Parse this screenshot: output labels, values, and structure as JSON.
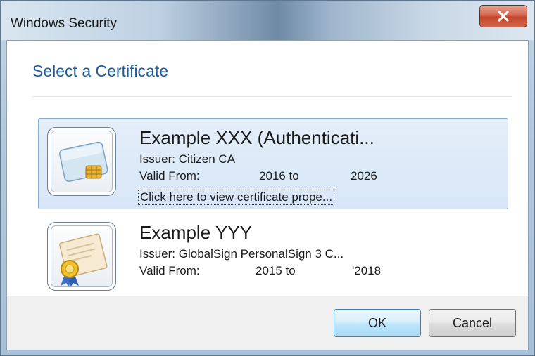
{
  "window": {
    "title": "Windows Security",
    "close_label": "X"
  },
  "dialog": {
    "heading": "Select a Certificate"
  },
  "certificates": [
    {
      "name": "Example XXX  (Authenticati...",
      "issuer": "Issuer: Citizen CA",
      "valid_label": "Valid From:",
      "valid_from": "2016 to",
      "valid_to": "2026",
      "link": "Click here to view certificate prope...",
      "icon": "smart-card-icon",
      "selected": true
    },
    {
      "name": "Example YYY",
      "issuer": "Issuer: GlobalSign PersonalSign 3 C...",
      "valid_label": "Valid From:",
      "valid_from": "2015 to",
      "valid_to": "'2018",
      "icon": "certificate-document-icon",
      "selected": false
    }
  ],
  "buttons": {
    "ok": "OK",
    "cancel": "Cancel"
  },
  "colors": {
    "heading": "#1e5b9a",
    "selection_border": "#84acd6",
    "selection_fill": "#dde9f8",
    "close_button": "#c2452b"
  }
}
